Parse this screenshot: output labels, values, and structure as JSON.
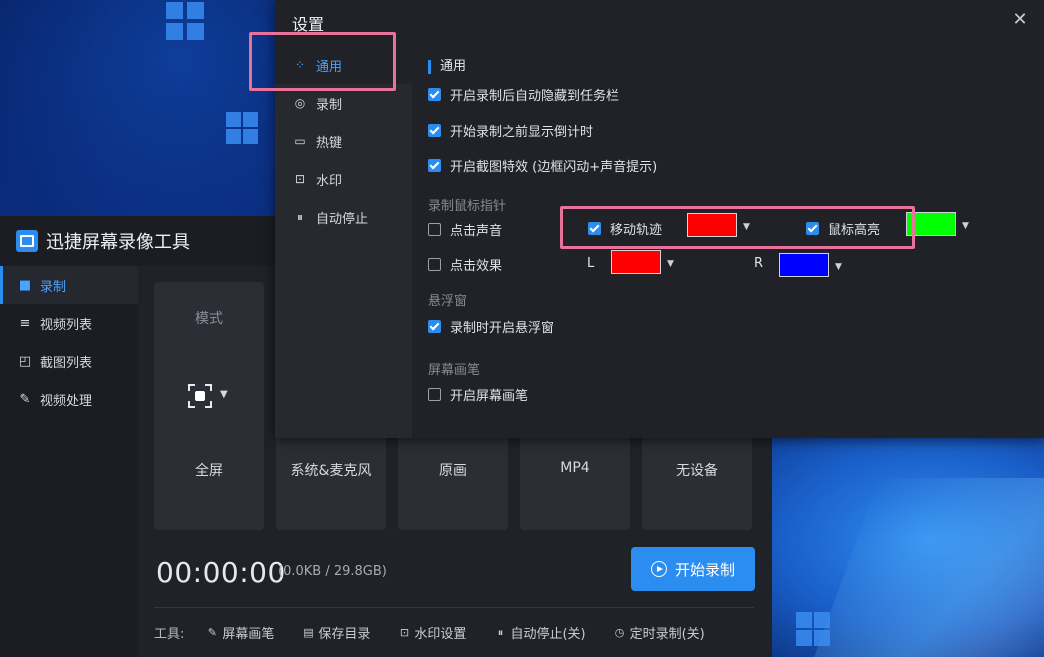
{
  "app": {
    "title": "迅捷屏幕录像工具",
    "sidebar": [
      {
        "label": "录制",
        "icon": "camera-icon",
        "active": true
      },
      {
        "label": "视频列表",
        "icon": "video-list-icon",
        "active": false
      },
      {
        "label": "截图列表",
        "icon": "screenshot-list-icon",
        "active": false
      },
      {
        "label": "视频处理",
        "icon": "video-process-icon",
        "active": false
      }
    ],
    "cards": {
      "mode_title": "模式",
      "mode_label": "全屏",
      "audio_label": "系统&麦克风",
      "quality_label": "原画",
      "format_label": "MP4",
      "camera_label": "无设备"
    },
    "timer": "00:00:00",
    "size_info": "(0.0KB / 29.8GB)",
    "start_button": "开始录制",
    "tools": {
      "label": "工具:",
      "items": [
        "屏幕画笔",
        "保存目录",
        "水印设置",
        "自动停止(关)",
        "定时录制(关)"
      ]
    }
  },
  "settings": {
    "title": "设置",
    "close": "✕",
    "nav": [
      {
        "label": "通用",
        "icon": "grid-icon",
        "active": true
      },
      {
        "label": "录制",
        "icon": "record-icon",
        "active": false
      },
      {
        "label": "热键",
        "icon": "keyboard-icon",
        "active": false
      },
      {
        "label": "水印",
        "icon": "watermark-icon",
        "active": false
      },
      {
        "label": "自动停止",
        "icon": "auto-stop-icon",
        "active": false
      }
    ],
    "section_title": "通用",
    "general": [
      {
        "label": "开启录制后自动隐藏到任务栏",
        "checked": true
      },
      {
        "label": "开始录制之前显示倒计时",
        "checked": true
      },
      {
        "label": "开启截图特效 (边框闪动+声音提示)",
        "checked": true
      }
    ],
    "cursor_group": {
      "title": "录制鼠标指针",
      "click_sound": {
        "label": "点击声音",
        "checked": false
      },
      "move_track": {
        "label": "移动轨迹",
        "checked": true,
        "color": "#ff0000"
      },
      "mouse_highlight": {
        "label": "鼠标高亮",
        "checked": true,
        "color": "#00ff00"
      },
      "click_effect": {
        "label": "点击效果",
        "checked": false
      },
      "left": {
        "label": "L",
        "color": "#ff0000"
      },
      "right": {
        "label": "R",
        "color": "#0000ff"
      }
    },
    "float_group": {
      "title": "悬浮窗",
      "option": {
        "label": "录制时开启悬浮窗",
        "checked": true
      }
    },
    "pen_group": {
      "title": "屏幕画笔",
      "option": {
        "label": "开启屏幕画笔",
        "checked": false
      }
    }
  },
  "colors": {
    "accent": "#2c8df0",
    "highlight_box": "#e8739a"
  }
}
